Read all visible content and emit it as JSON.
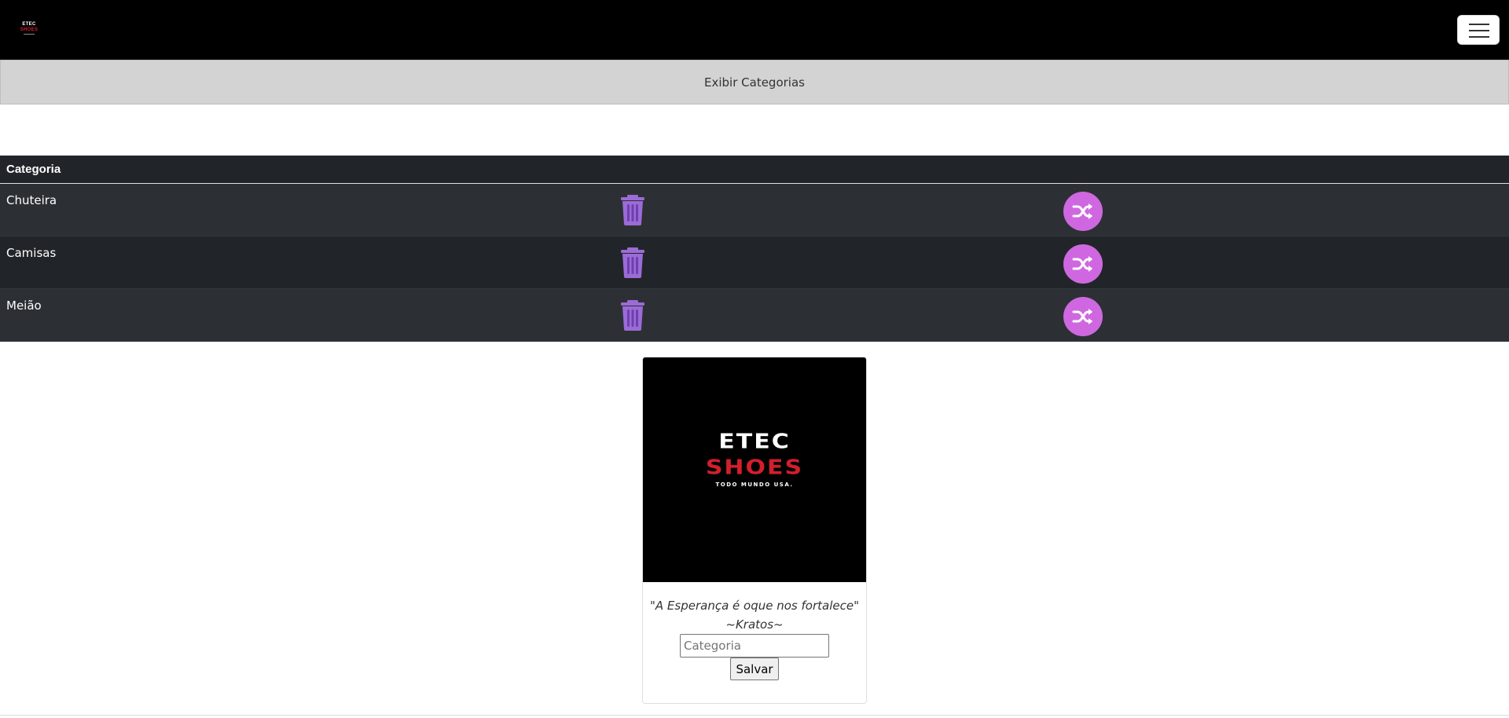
{
  "navbar": {
    "logo_line1": "ETEC",
    "logo_line2": "SHOES",
    "toggler_icon": "hamburger-icon"
  },
  "show_categories_label": "Exibir Categorias",
  "table": {
    "header": "Categoria",
    "rows": [
      {
        "name": "Chuteira"
      },
      {
        "name": "Camisas"
      },
      {
        "name": "Meião"
      }
    ],
    "delete_icon": "trash-icon",
    "edit_icon": "shuffle-icon",
    "icon_colors": {
      "trash": "#9b6bd6",
      "shuffle": "#cf68e0"
    }
  },
  "card": {
    "brand_line1": "ETEC",
    "brand_line2": "SHOES",
    "brand_tagline": "TODO MUNDO USA.",
    "quote": "\"A Esperança é oque nos fortalece\"",
    "author": "~Kratos~",
    "input_placeholder": "Categoria",
    "input_value": "",
    "save_label": "Salvar"
  },
  "colors": {
    "navbar": "#000000",
    "brand_red": "#d21f2b",
    "table_dark": "#212529"
  }
}
